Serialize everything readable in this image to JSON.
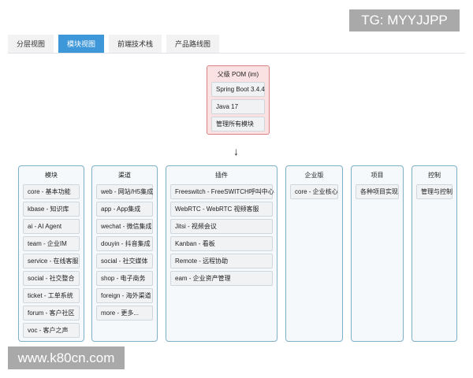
{
  "watermarks": {
    "top": "TG: MYYJJPP",
    "bottom": "www.k80cn.com"
  },
  "tabs": [
    {
      "label": "分层视图"
    },
    {
      "label": "模块视图",
      "active": true
    },
    {
      "label": "前端技术栈"
    },
    {
      "label": "产品路线图"
    }
  ],
  "pom": {
    "title": "父级 POM (im)",
    "items": [
      "Spring Boot 3.4.4",
      "Java 17",
      "管理所有模块"
    ]
  },
  "arrow": "↓",
  "columns": [
    {
      "title": "模块",
      "items": [
        "core - 基本功能",
        "kbase - 知识库",
        "ai - AI Agent",
        "team - 企业IM",
        "service - 在线客服",
        "social - 社交整合",
        "ticket - 工单系统",
        "forum - 客户社区",
        "voc - 客户之声"
      ]
    },
    {
      "title": "渠道",
      "items": [
        "web - 网站/H5集成",
        "app - App集成",
        "wechat - 微信集成",
        "douyin - 抖音集成",
        "social - 社交媒体",
        "shop - 电子商务",
        "foreign - 海外渠道",
        "more - 更多..."
      ]
    },
    {
      "title": "插件",
      "items": [
        "Freeswitch - FreeSWITCH呼叫中心",
        "WebRTC - WebRTC 视频客服",
        "Jitsi - 视频会议",
        "Kanban - 看板",
        "Remote - 远程协助",
        "eam - 企业资产管理"
      ]
    },
    {
      "title": "企业版",
      "items": [
        "core - 企业核心"
      ]
    },
    {
      "title": "项目",
      "items": [
        "各种项目实现"
      ]
    },
    {
      "title": "控制",
      "items": [
        "管理与控制"
      ]
    }
  ]
}
